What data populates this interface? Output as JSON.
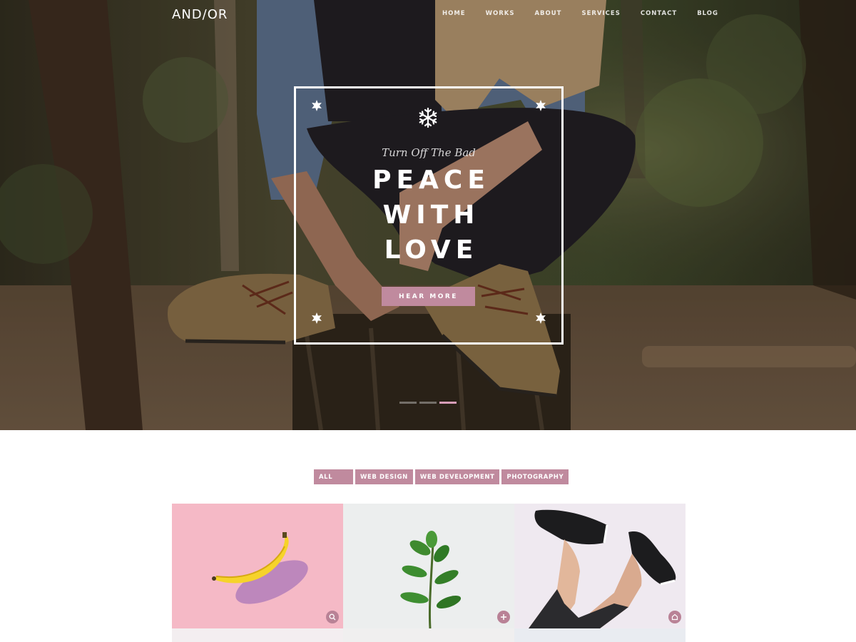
{
  "brand": {
    "logo": "AND/OR"
  },
  "nav": {
    "items": [
      "HOME",
      "WORKS",
      "ABOUT",
      "SERVICES",
      "CONTACT",
      "BLOG"
    ]
  },
  "hero": {
    "tagline": "Turn Off The Bad",
    "headline": [
      "PEACE",
      "WITH",
      "LOVE"
    ],
    "cta_label": "HEAR MORE",
    "slides_total": 3,
    "active_slide": 3
  },
  "portfolio": {
    "filters": [
      "ALL",
      "WEB DESIGN",
      "WEB DEVELOPMENT",
      "PHOTOGRAPHY"
    ],
    "active_filter": "ALL",
    "tiles": [
      {
        "subject": "banana",
        "icon": "search-icon"
      },
      {
        "subject": "plant",
        "icon": "plus-icon"
      },
      {
        "subject": "sneakers",
        "icon": "link-icon"
      }
    ]
  },
  "colors": {
    "accent": "#c08a9e",
    "tile_pink": "#f5b9c6",
    "tile_grey": "#eceeee",
    "tile_lilac": "#efe9f0"
  }
}
